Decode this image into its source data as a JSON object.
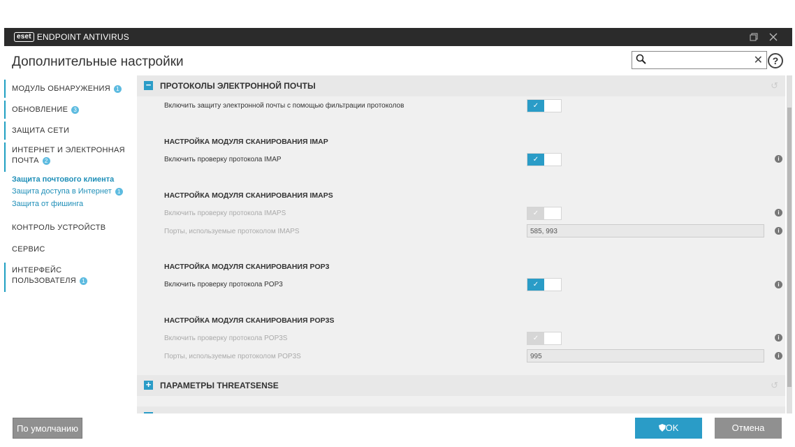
{
  "window": {
    "brand_logo": "eset",
    "brand_name": "ENDPOINT ANTIVIRUS",
    "restore_icon": "restore-icon",
    "close_icon": "close-icon"
  },
  "header": {
    "title": "Дополнительные настройки",
    "search_value": "",
    "search_placeholder": "",
    "help_label": "?"
  },
  "sidebar": {
    "items": [
      {
        "label": "МОДУЛЬ ОБНАРУЖЕНИЯ",
        "badge": "1"
      },
      {
        "label": "ОБНОВЛЕНИЕ",
        "badge": "3"
      },
      {
        "label": "ЗАЩИТА СЕТИ"
      },
      {
        "label_line1": "ИНТЕРНЕТ И ЭЛЕКТРОННАЯ",
        "label_line2": "ПОЧТА",
        "badge": "2"
      },
      {
        "label": "КОНТРОЛЬ УСТРОЙСТВ"
      },
      {
        "label": "СЕРВИС"
      },
      {
        "label_line1": "ИНТЕРФЕЙС",
        "label_line2": "ПОЛЬЗОВАТЕЛЯ",
        "badge": "1"
      }
    ],
    "subitems": [
      {
        "label": "Защита почтового клиента",
        "active": true
      },
      {
        "label": "Защита доступа в Интернет",
        "badge": "1"
      },
      {
        "label": "Защита от фишинга"
      }
    ]
  },
  "content": {
    "section1": {
      "title": "ПРОТОКОЛЫ ЭЛЕКТРОННОЙ ПОЧТЫ",
      "toggle_sign": "−",
      "enable_label": "Включить защиту электронной почты с помощью фильтрации протоколов",
      "enable_value": true
    },
    "imap": {
      "title": "НАСТРОЙКА МОДУЛЯ СКАНИРОВАНИЯ IMAP",
      "enable_label": "Включить проверку протокола IMAP",
      "enable_value": true
    },
    "imaps": {
      "title": "НАСТРОЙКА МОДУЛЯ СКАНИРОВАНИЯ IMAPS",
      "enable_label": "Включить проверку протокола IMAPS",
      "enable_value": true,
      "enabled": false,
      "ports_label": "Порты, используемые протоколом IMAPS",
      "ports_value": "585, 993"
    },
    "pop3": {
      "title": "НАСТРОЙКА МОДУЛЯ СКАНИРОВАНИЯ POP3",
      "enable_label": "Включить проверку протокола POP3",
      "enable_value": true
    },
    "pop3s": {
      "title": "НАСТРОЙКА МОДУЛЯ СКАНИРОВАНИЯ POP3S",
      "enable_label": "Включить проверку протокола POP3S",
      "enable_value": true,
      "enabled": false,
      "ports_label": "Порты, используемые протоколом POP3S",
      "ports_value": "995"
    },
    "section2": {
      "title": "ПАРАМЕТРЫ THREATSENSE",
      "toggle_sign": "+"
    }
  },
  "footer": {
    "default_label": "По умолчанию",
    "ok_label": "OK",
    "cancel_label": "Отмена"
  },
  "colors": {
    "accent": "#2a9cc7",
    "titlebar": "#2b2b2b",
    "button_gray": "#909090"
  }
}
